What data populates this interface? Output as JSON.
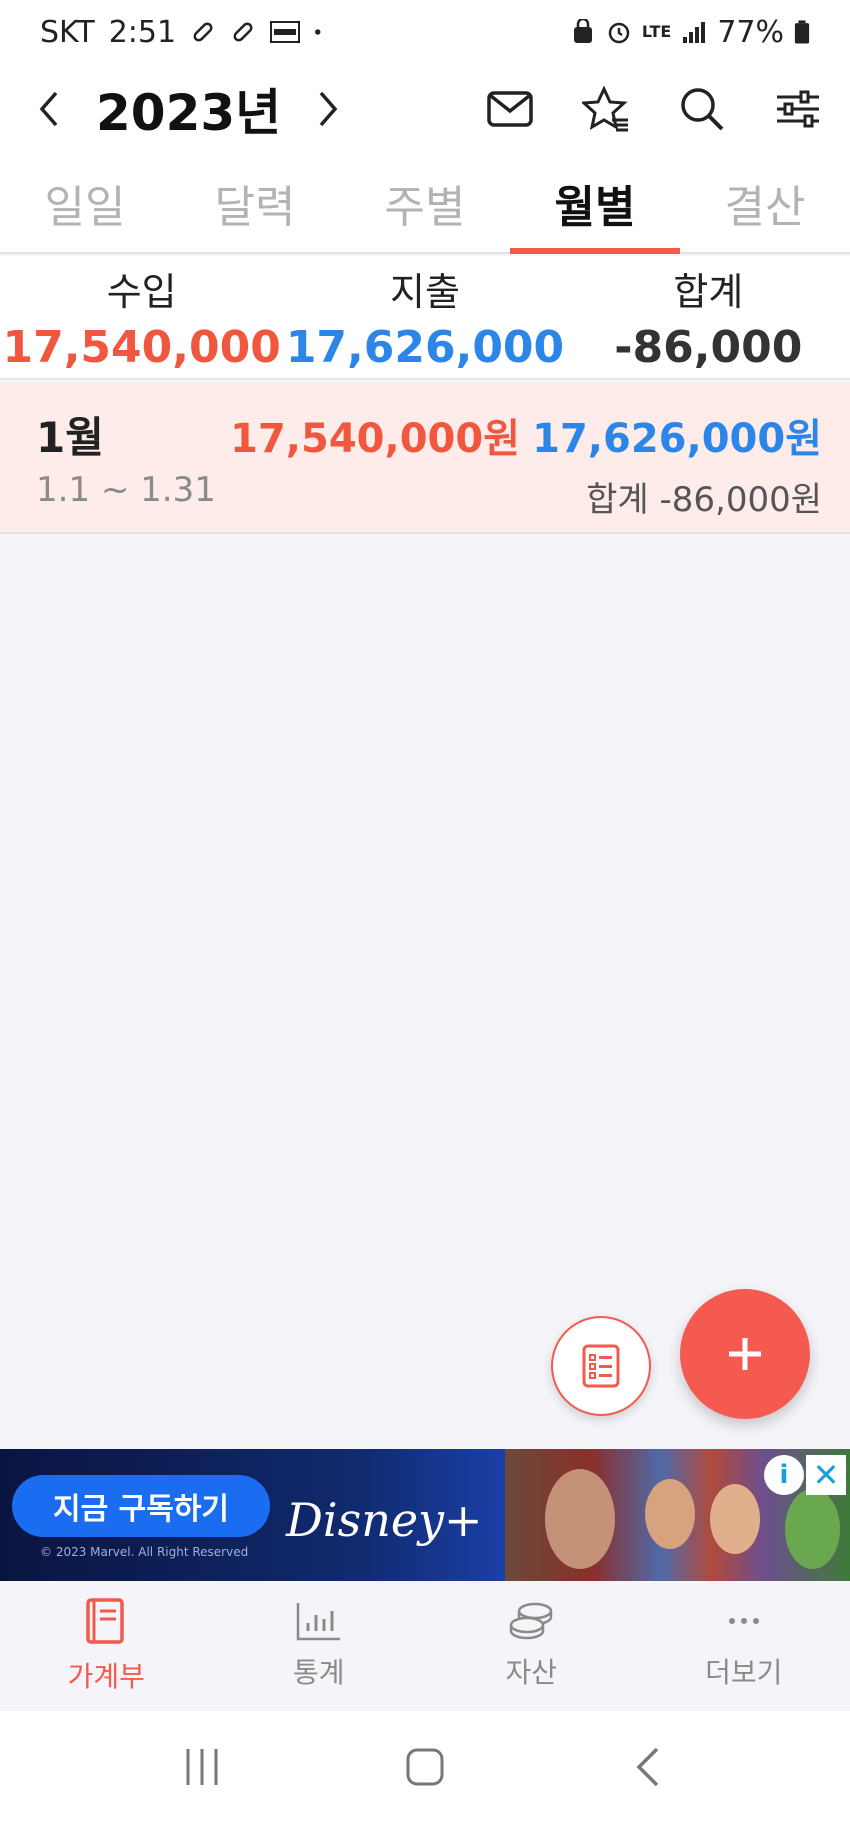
{
  "status_bar": {
    "carrier": "SKT",
    "time": "2:51",
    "network": "LTE",
    "battery": "77%",
    "icons": [
      "pill-icon",
      "pill-icon",
      "payco-icon",
      "dot-icon",
      "vpn-icon",
      "alarm-icon",
      "lte-icon",
      "signal-icon",
      "battery-icon"
    ]
  },
  "header": {
    "title": "2023년",
    "icons": [
      "chevron-left-icon",
      "chevron-right-icon",
      "mail-icon",
      "star-icon",
      "search-icon",
      "filter-icon"
    ]
  },
  "tabs": [
    {
      "label": "일일",
      "active": false
    },
    {
      "label": "달력",
      "active": false
    },
    {
      "label": "주별",
      "active": false
    },
    {
      "label": "월별",
      "active": true
    },
    {
      "label": "결산",
      "active": false
    }
  ],
  "summary": {
    "income_label": "수입",
    "income_value": "17,540,000",
    "expense_label": "지출",
    "expense_value": "17,626,000",
    "total_label": "합계",
    "total_value": "-86,000"
  },
  "months": [
    {
      "name": "1월",
      "range": "1.1 ~ 1.31",
      "income": "17,540,000원",
      "expense": "17,626,000원",
      "total": "합계 -86,000원"
    }
  ],
  "ad": {
    "cta": "지금 구독하기",
    "brand": "Disney+",
    "copyright": "© 2023 Marvel. All Right Reserved",
    "info": "i",
    "close": "✕"
  },
  "bottom_nav": [
    {
      "label": "가계부",
      "icon": "book-icon",
      "active": true
    },
    {
      "label": "통계",
      "icon": "bar-chart-icon",
      "active": false
    },
    {
      "label": "자산",
      "icon": "coins-icon",
      "active": false
    },
    {
      "label": "더보기",
      "icon": "more-icon",
      "active": false
    }
  ],
  "colors": {
    "accent": "#f15a4d",
    "income": "#f1573e",
    "expense": "#2c86e8",
    "month_row_bg": "#fdecea"
  }
}
